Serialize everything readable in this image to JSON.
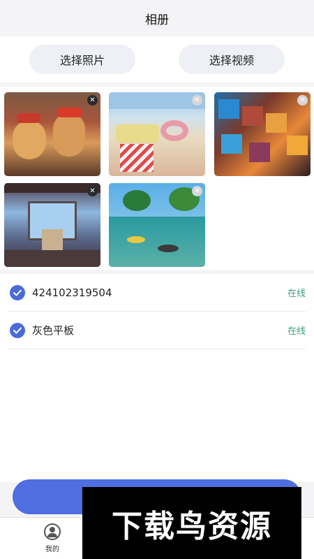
{
  "header": {
    "title": "相册"
  },
  "pickers": {
    "photo_label": "选择照片",
    "video_label": "选择视频"
  },
  "photos": [
    {
      "name": "teddy-bears"
    },
    {
      "name": "beach-pool"
    },
    {
      "name": "color-cubes"
    },
    {
      "name": "anime-room"
    },
    {
      "name": "tropical-fish"
    }
  ],
  "devices": [
    {
      "name": "424102319504",
      "status": "在线"
    },
    {
      "name": "灰色平板",
      "status": "在线"
    }
  ],
  "tabbar": {
    "me_label": "我的"
  },
  "watermark": {
    "text": "下载鸟资源"
  },
  "colors": {
    "accent": "#4f6ee0",
    "online": "#3aa07a",
    "check": "#4a6ad8"
  }
}
